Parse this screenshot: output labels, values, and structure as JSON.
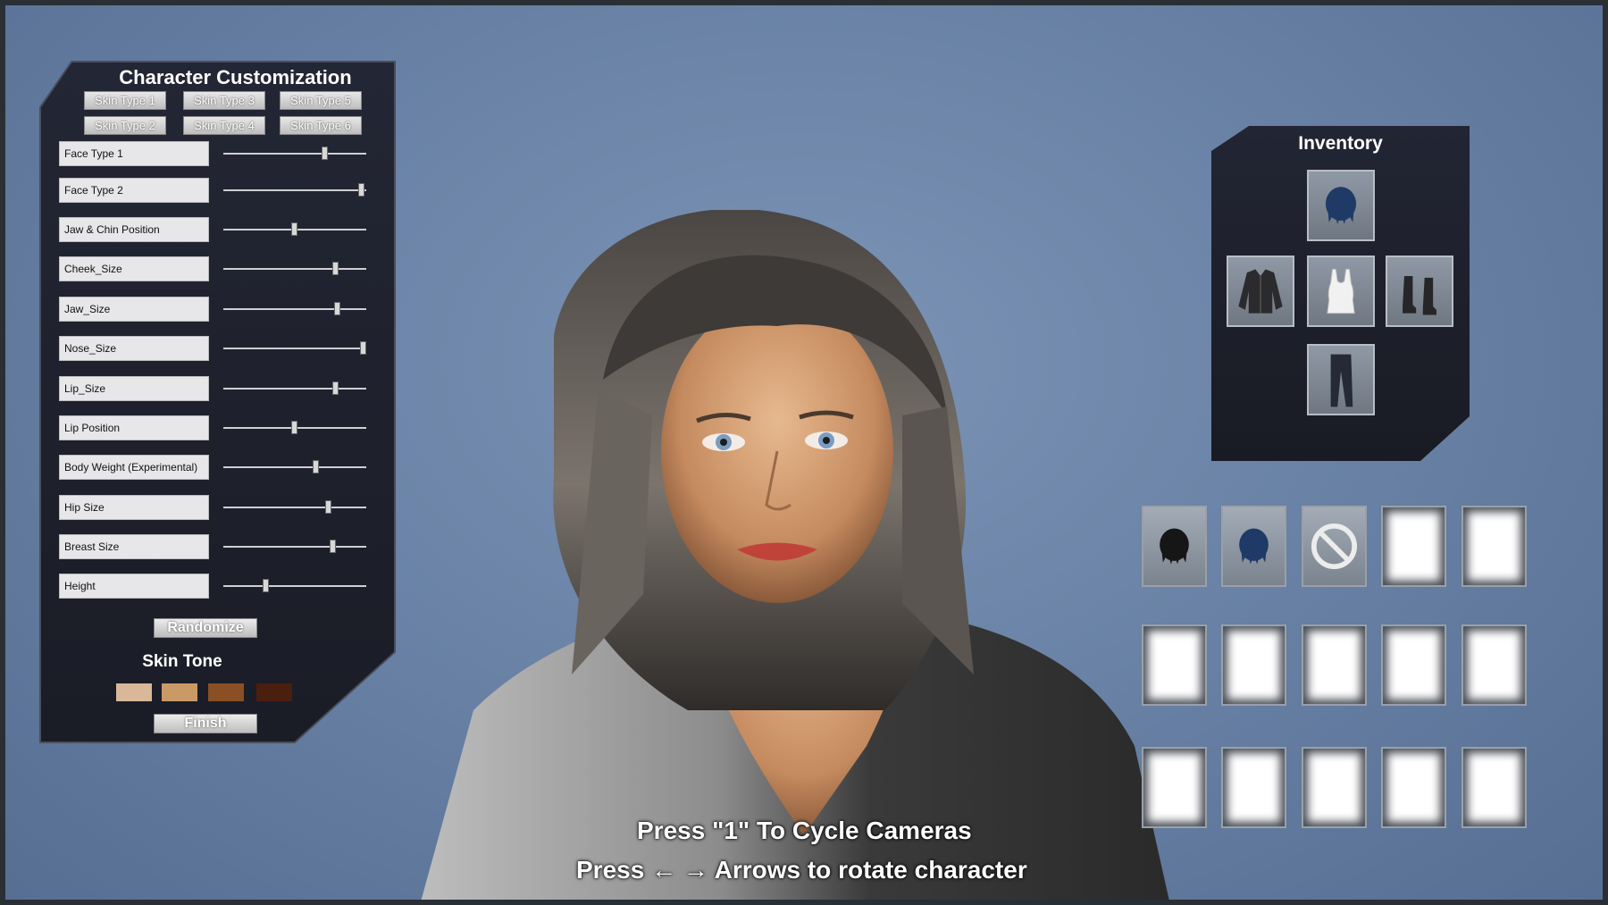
{
  "customization": {
    "title": "Character Customization",
    "skin_types": [
      "Skin Type 1",
      "Skin Type 2",
      "Skin Type 3",
      "Skin Type 4",
      "Skin Type 5",
      "Skin Type 6"
    ],
    "sliders": [
      {
        "label": "Face Type 1",
        "value": 0.71
      },
      {
        "label": "Face Type 2",
        "value": 0.97
      },
      {
        "label": "Jaw & Chin Position",
        "value": 0.5
      },
      {
        "label": "Cheek_Size",
        "value": 0.79
      },
      {
        "label": "Jaw_Size",
        "value": 0.8
      },
      {
        "label": "Nose_Size",
        "value": 0.98
      },
      {
        "label": "Lip_Size",
        "value": 0.79
      },
      {
        "label": "Lip Position",
        "value": 0.5
      },
      {
        "label": "Body Weight (Experimental)",
        "value": 0.65
      },
      {
        "label": "Hip Size",
        "value": 0.74
      },
      {
        "label": "Breast Size",
        "value": 0.77
      },
      {
        "label": "Height",
        "value": 0.3
      }
    ],
    "randomize_label": "Randomize",
    "skin_tone_title": "Skin Tone",
    "skin_tones": [
      "#d8b898",
      "#c99a66",
      "#8a4f24",
      "#4a1f0e"
    ],
    "finish_label": "Finish"
  },
  "inventory": {
    "title": "Inventory",
    "slots": [
      "hair-icon",
      "jacket-icon",
      "tank-top-icon",
      "boots-icon",
      "jeans-icon"
    ]
  },
  "item_grid": {
    "items": [
      "hair-icon",
      "hair-icon",
      "none-icon",
      "empty",
      "empty",
      "empty",
      "empty",
      "empty",
      "empty",
      "empty",
      "empty",
      "empty",
      "empty",
      "empty",
      "empty"
    ]
  },
  "instructions": {
    "line1": "Press \"1\" To Cycle Cameras",
    "line2_prefix": "Press",
    "line2_arrows": "← →",
    "line2_suffix": "Arrows to rotate character"
  }
}
